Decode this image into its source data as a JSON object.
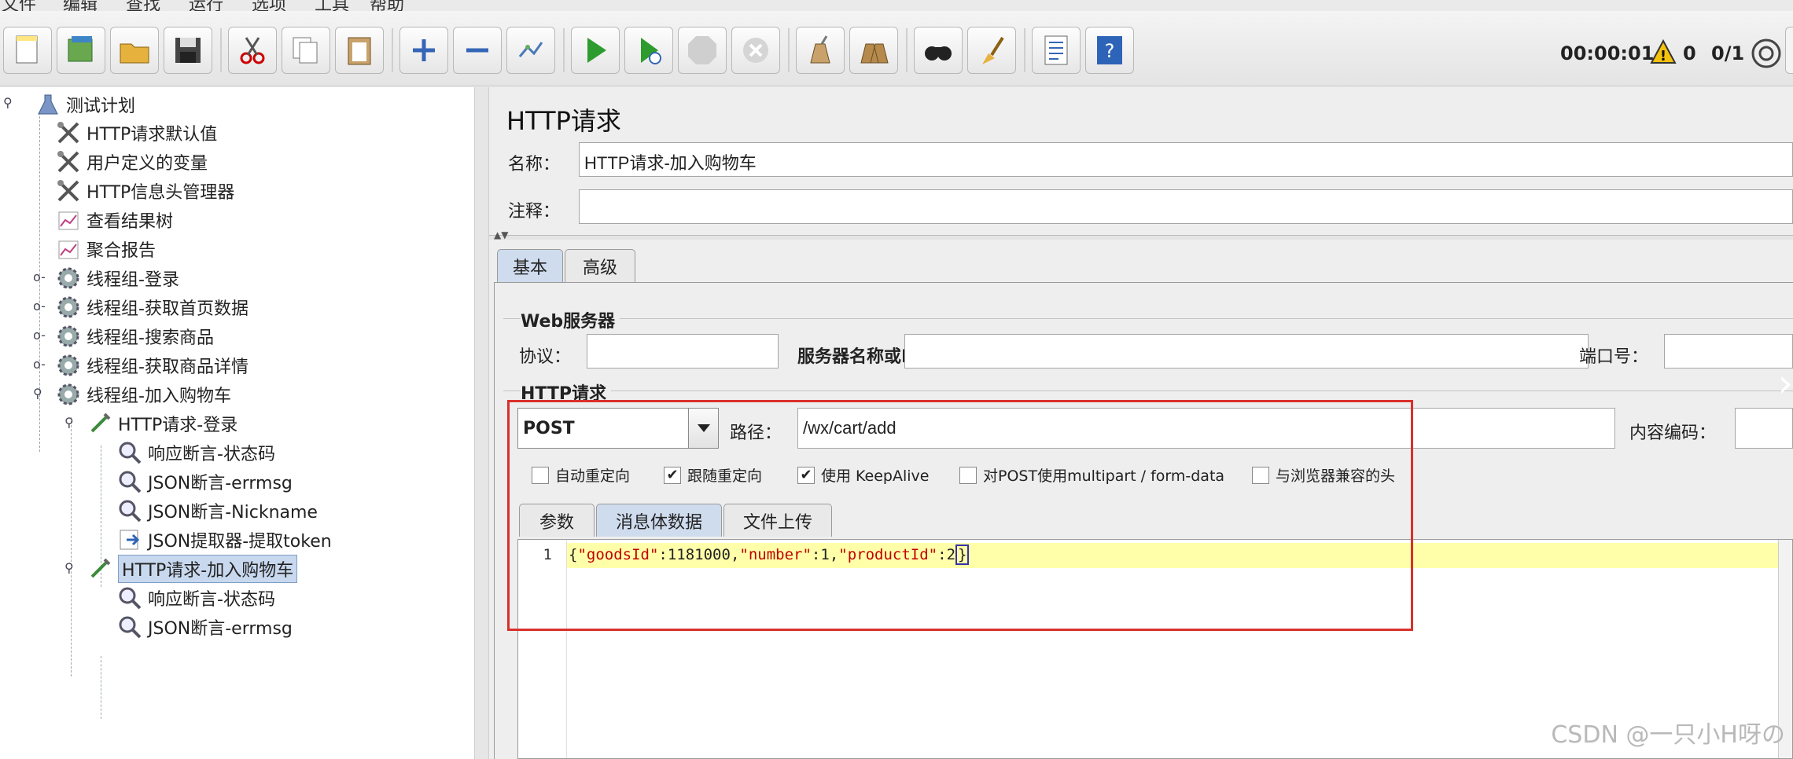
{
  "menu": [
    "文件",
    "编辑",
    "查找",
    "运行",
    "选项",
    "工具",
    "帮助"
  ],
  "toolbar": {
    "buttons": [
      "new-icon",
      "templates-icon",
      "open-icon",
      "save-icon",
      "cut-icon",
      "copy-icon",
      "paste-icon",
      "expand-icon",
      "collapse-icon",
      "toggle-icon",
      "start-icon",
      "start-no-pause-icon",
      "stop-icon",
      "shutdown-icon",
      "clear-icon",
      "clear-all-icon",
      "search-icon",
      "reset-search-icon",
      "function-helper-icon",
      "help-icon"
    ],
    "timer": "00:00:01",
    "warning_count": "0",
    "threads": "0/1"
  },
  "tree": {
    "root": "测试计划",
    "items": [
      {
        "label": "HTTP请求默认值"
      },
      {
        "label": "用户定义的变量"
      },
      {
        "label": "HTTP信息头管理器"
      },
      {
        "label": "查看结果树"
      },
      {
        "label": "聚合报告"
      },
      {
        "label": "线程组-登录"
      },
      {
        "label": "线程组-获取首页数据"
      },
      {
        "label": "线程组-搜索商品"
      },
      {
        "label": "线程组-获取商品详情"
      },
      {
        "label": "线程组-加入购物车"
      },
      {
        "label": "HTTP请求-登录"
      },
      {
        "label": "响应断言-状态码"
      },
      {
        "label": "JSON断言-errmsg"
      },
      {
        "label": "JSON断言-Nickname"
      },
      {
        "label": "JSON提取器-提取token"
      },
      {
        "label": "HTTP请求-加入购物车"
      },
      {
        "label": "响应断言-状态码"
      },
      {
        "label": "JSON断言-errmsg"
      }
    ]
  },
  "panel": {
    "title": "HTTP请求",
    "name_label": "名称：",
    "name_value": "HTTP请求-加入购物车",
    "comment_label": "注释：",
    "comment_value": "",
    "tabs": [
      "基本",
      "高级"
    ],
    "web_server": {
      "title": "Web服务器",
      "protocol_label": "协议：",
      "protocol_value": "",
      "server_label": "服务器名称或IP：",
      "server_value": "",
      "port_label": "端口号：",
      "port_value": ""
    },
    "http_request": {
      "title": "HTTP请求",
      "method": "POST",
      "path_label": "路径：",
      "path_value": "/wx/cart/add",
      "encoding_label": "内容编码：",
      "encoding_value": ""
    },
    "options": [
      {
        "label": "自动重定向",
        "checked": false
      },
      {
        "label": "跟随重定向",
        "checked": true
      },
      {
        "label": "使用 KeepAlive",
        "checked": true
      },
      {
        "label": "对POST使用multipart / form-data",
        "checked": false
      },
      {
        "label": "与浏览器兼容的头",
        "checked": false
      }
    ],
    "body_tabs": [
      "参数",
      "消息体数据",
      "文件上传"
    ],
    "body": {
      "line_number": "1",
      "k1": "\"goodsId\"",
      "v1": "1181000",
      "k2": "\"number\"",
      "v2": "1",
      "k3": "\"productId\"",
      "v3": "2"
    }
  },
  "watermark": "CSDN @一只小H呀の"
}
